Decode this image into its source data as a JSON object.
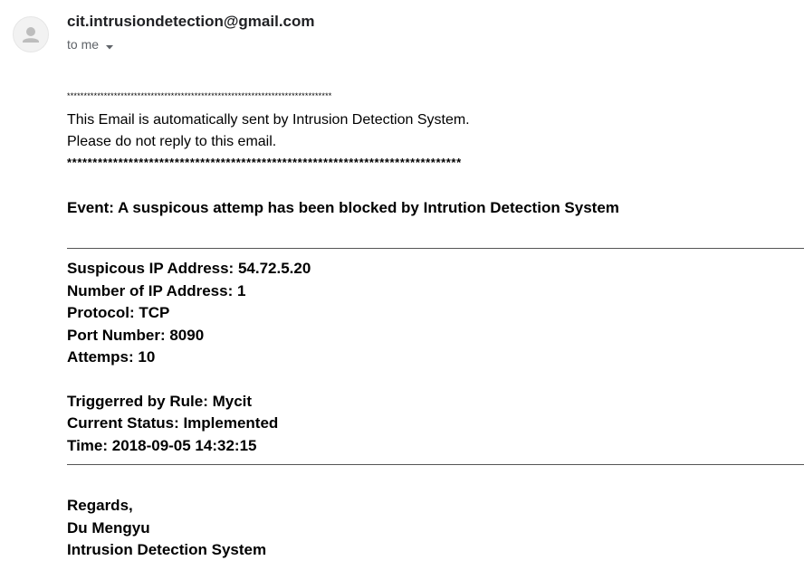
{
  "header": {
    "sender_email": "cit.intrusiondetection@gmail.com",
    "recipient_label": "to me",
    "icons": {
      "avatar": "person-avatar-icon",
      "recipient_details": "caret-down-icon"
    }
  },
  "message": {
    "stars_top": "*******************************************************************************",
    "notice_line1": "This Email is automatically sent by Intrusion Detection System.",
    "notice_line2": "Please do not reply to this email.",
    "stars_bottom": "*****************************************************************************",
    "event_line": "Event: A suspicous attemp has been blocked by Intrution Detection System",
    "details": {
      "ip": "Suspicous IP Address: 54.72.5.20",
      "ip_count": "Number of IP Address: 1",
      "protocol": "Protocol: TCP",
      "port": "Port Number: 8090",
      "attempts": "Attemps: 10",
      "rule": "Triggerred by Rule: Mycit",
      "status": "Current Status: Implemented",
      "time": "Time: 2018-09-05 14:32:15"
    },
    "signature": {
      "closing": "Regards,",
      "name": "Du Mengyu",
      "system": "Intrusion Detection System"
    }
  },
  "colors": {
    "sender": "#202124",
    "secondary": "#5f6368",
    "avatar_bg": "#f2f2f2",
    "avatar_icon": "#bdbdbd",
    "rule": "#555555"
  }
}
